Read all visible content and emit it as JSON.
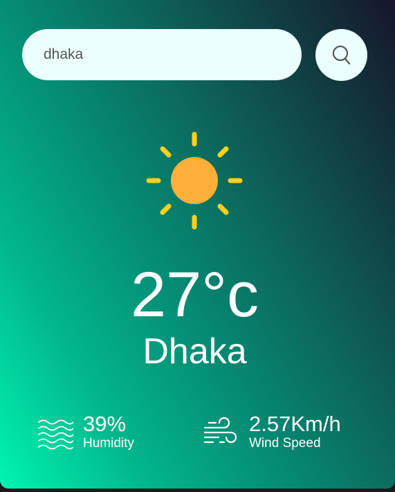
{
  "search": {
    "value": "dhaka"
  },
  "weather": {
    "icon": "sun-icon",
    "temperature": "27°c",
    "city": "Dhaka"
  },
  "details": {
    "humidity": {
      "icon": "humidity-waves-icon",
      "value": "39%",
      "label": "Humidity"
    },
    "wind": {
      "icon": "wind-icon",
      "value": "2.57Km/h",
      "label": "Wind Speed"
    }
  },
  "colors": {
    "gradient_start": "#00f5b0",
    "gradient_end": "#17152c",
    "input_bg": "#ebfffc",
    "sun_body": "#ffaf38",
    "sun_rays": "#ffd11a"
  }
}
